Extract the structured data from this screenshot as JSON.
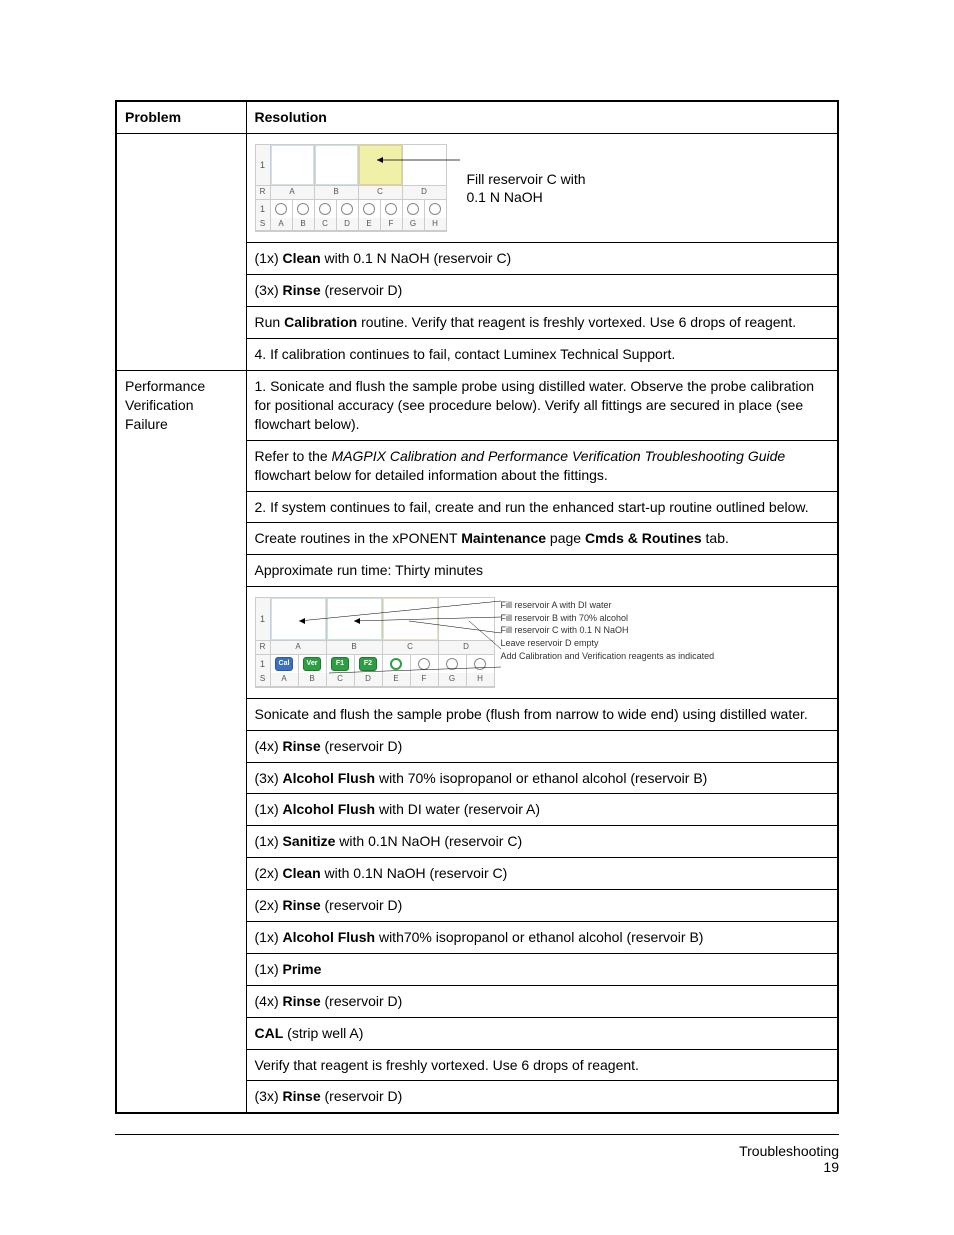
{
  "header": {
    "col_problem": "Problem",
    "col_resolution": "Resolution"
  },
  "diagram1": {
    "row_label_top": "1",
    "row_label_mid": "R",
    "row_label_well_num": "1",
    "row_label_well_strip": "S",
    "res_letters": [
      "A",
      "B",
      "C",
      "D"
    ],
    "well_letters": [
      "A",
      "B",
      "C",
      "D",
      "E",
      "F",
      "G",
      "H"
    ],
    "callout_line1": "Fill reservoir C with",
    "callout_line2": "0.1 N NaOH"
  },
  "rows_top": [
    {
      "html": "(1x) <b>Clean</b> with 0.1 N NaOH (reservoir C)"
    },
    {
      "html": "(3x) <b>Rinse</b> (reservoir D)"
    },
    {
      "html": "Run <b>Calibration</b> routine. Verify that reagent is freshly vortexed. Use 6 drops of reagent."
    },
    {
      "html": "4. If calibration continues to fail, contact Luminex Technical Support."
    }
  ],
  "problem2": "Performance Verification Failure",
  "rows_pvf_a": [
    {
      "html": "1. Sonicate and flush the sample probe using distilled water. Observe the probe calibration for positional accuracy (see procedure below). Verify all fittings are secured in place (see flowchart below)."
    },
    {
      "html": "Refer to the <i>MAGPIX Calibration and Performance Verification Troubleshooting Guide</i> flowchart below for detailed information about the fittings."
    },
    {
      "html": "2. If system continues to fail, create and run the enhanced start-up routine outlined below."
    },
    {
      "html": "Create routines in the xPONENT <b>Maintenance</b> page <b>Cmds & Routines</b> tab."
    },
    {
      "html": "Approximate run time: Thirty minutes"
    }
  ],
  "diagram2": {
    "row_label_top": "1",
    "row_label_mid": "R",
    "row_label_well_num": "1",
    "row_label_well_strip": "S",
    "res_letters": [
      "A",
      "B",
      "C",
      "D"
    ],
    "well_letters": [
      "A",
      "B",
      "C",
      "D",
      "E",
      "F",
      "G",
      "H"
    ],
    "well_badges": [
      "Cal",
      "Ver",
      "F1",
      "F2",
      "",
      "",
      "",
      ""
    ],
    "callouts": [
      "Fill reservoir A with DI water",
      "Fill reservoir B with 70% alcohol",
      "Fill reservoir C with 0.1 N NaOH",
      "Leave reservoir D empty",
      "Add Calibration and Verification reagents as indicated"
    ]
  },
  "rows_pvf_b": [
    {
      "html": "Sonicate and flush the sample probe (flush from narrow to wide end) using distilled water."
    },
    {
      "html": "(4x) <b>Rinse</b> (reservoir D)"
    },
    {
      "html": "(3x) <b>Alcohol Flush</b> with 70% isopropanol or ethanol alcohol (reservoir B)"
    },
    {
      "html": "(1x) <b>Alcohol Flush</b> with DI water (reservoir A)"
    },
    {
      "html": "(1x) <b>Sanitize</b> with 0.1N NaOH (reservoir C)"
    },
    {
      "html": "(2x) <b>Clean</b> with 0.1N NaOH (reservoir C)"
    },
    {
      "html": "(2x) <b>Rinse</b> (reservoir D)"
    },
    {
      "html": "(1x) <b>Alcohol Flush</b> with70% isopropanol or ethanol alcohol (reservoir B)"
    },
    {
      "html": "(1x) <b>Prime</b>"
    },
    {
      "html": "(4x) <b>Rinse</b> (reservoir D)"
    },
    {
      "html": "<b>CAL</b> (strip well A)"
    },
    {
      "html": "Verify that reagent is freshly vortexed. Use 6 drops of reagent."
    },
    {
      "html": "(3x) <b>Rinse</b> (reservoir D)"
    }
  ],
  "footer": {
    "section": "Troubleshooting",
    "page": "19"
  }
}
